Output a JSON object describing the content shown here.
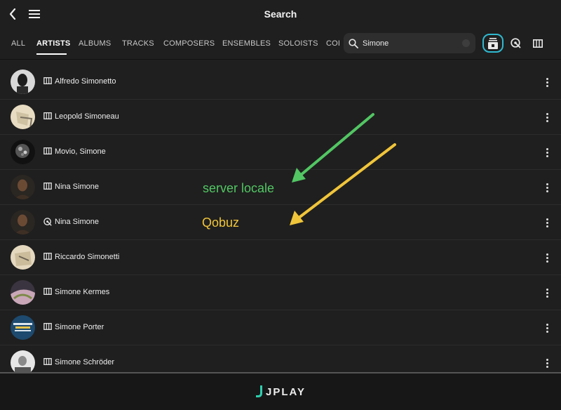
{
  "header": {
    "title": "Search"
  },
  "tabs": [
    {
      "label": "ALL"
    },
    {
      "label": "ARTISTS"
    },
    {
      "label": "ALBUMS"
    },
    {
      "label": "TRACKS"
    },
    {
      "label": "COMPOSERS"
    },
    {
      "label": "ENSEMBLES"
    },
    {
      "label": "SOLOISTS"
    },
    {
      "label": "COI"
    }
  ],
  "active_tab": "ARTISTS",
  "search": {
    "value": "Simone"
  },
  "filters": [
    {
      "name": "all-sources",
      "icon": "library-stack-icon",
      "active": true
    },
    {
      "name": "qobuz",
      "icon": "qobuz-icon",
      "active": false
    },
    {
      "name": "local-server",
      "icon": "server-icon",
      "active": false
    }
  ],
  "rows": [
    {
      "name": "Alfredo Simonetto",
      "source": "local-server"
    },
    {
      "name": "Leopold Simoneau",
      "source": "local-server"
    },
    {
      "name": "Movio, Simone",
      "source": "local-server"
    },
    {
      "name": "Nina Simone",
      "source": "local-server"
    },
    {
      "name": "Nina Simone",
      "source": "qobuz"
    },
    {
      "name": "Riccardo Simonetti",
      "source": "local-server"
    },
    {
      "name": "Simone Kermes",
      "source": "local-server"
    },
    {
      "name": "Simone Porter",
      "source": "local-server"
    },
    {
      "name": "Simone Schröder",
      "source": "local-server"
    }
  ],
  "annotations": {
    "green": {
      "text": "server locale",
      "color": "#52c663"
    },
    "yellow": {
      "text": "Qobuz",
      "color": "#f0c53a"
    }
  },
  "footer": {
    "logo_text": "JPLAY",
    "accent": "#2fcfae"
  },
  "colors": {
    "active_filter_ring": "#2fb9d0",
    "background": "#1f1f1f"
  }
}
